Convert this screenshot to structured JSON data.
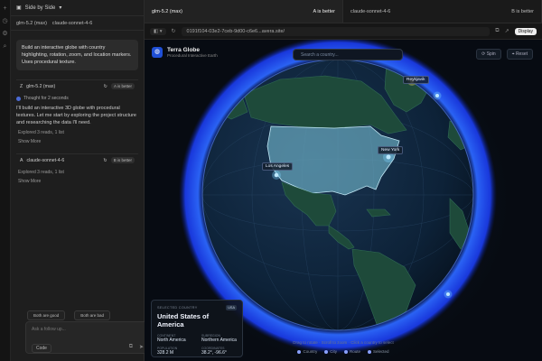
{
  "left_pane": {
    "header": {
      "title": "Side by Side"
    },
    "models": [
      {
        "label": "glm-5.2 (max)"
      },
      {
        "label": "claude-sonnet-4-6"
      }
    ],
    "user_prompt": "Build an interactive globe with country highlighting, rotation, zoom, and location markers. Uses procedural texture.",
    "responses": [
      {
        "model": "glm-5.2 (max)",
        "badge": "A is better",
        "thought": "Thought for 2 seconds",
        "text": "I'll build an interactive 3D globe with procedural textures. Let me start by exploring the project structure and researching the data I'll need.",
        "explored": "Explored  3 reads, 1 list",
        "show_more": "Show More"
      },
      {
        "model": "claude-sonnet-4-6",
        "badge": "B is better",
        "explored": "Explored  3 reads, 1 list",
        "show_more": "Show More"
      }
    ],
    "votes": [
      "Both are good",
      "Both are bad"
    ],
    "composer": {
      "placeholder": "Ask a follow up...",
      "code_label": "Code"
    }
  },
  "browser": {
    "tabs": [
      {
        "label": "glm-5.2 (max)",
        "badge": "A is better"
      },
      {
        "label": "claude-sonnet-4-6",
        "badge": "B is better"
      }
    ],
    "url": "0191f104-03e2-7ceb-9d00-c6e6...avera.site/",
    "display_button": "Display"
  },
  "app": {
    "brand_title": "Terra Globe",
    "brand_subtitle": "Procedural Interactive Earth",
    "search_placeholder": "Search a country...",
    "spin_label": "Spin",
    "reset_label": "Reset",
    "markers": [
      {
        "label": "Los Angeles"
      },
      {
        "label": "New York"
      },
      {
        "label": "Reykjavik"
      }
    ],
    "selected": {
      "kicker": "SELECTED COUNTRY",
      "name": "United States of America",
      "tag": "USA",
      "fields": [
        {
          "label": "CONTINENT",
          "value": "North America"
        },
        {
          "label": "SUBREGION",
          "value": "Northern America"
        },
        {
          "label": "POPULATION",
          "value": "328.2 M"
        },
        {
          "label": "COORDINATES",
          "value": "38.2°, -96.6°"
        }
      ]
    },
    "hint": "Drag to rotate  ·  Scroll to zoom  ·  Click a country to select",
    "legend": [
      "Country",
      "City",
      "Route",
      "Selected"
    ]
  },
  "colors": {
    "atmosphere": "#1d4fff",
    "ocean": "#0b1e33",
    "land": "#1e4a3a",
    "selected_land": "#6fb2c8",
    "marker": "#7fd3ff"
  }
}
